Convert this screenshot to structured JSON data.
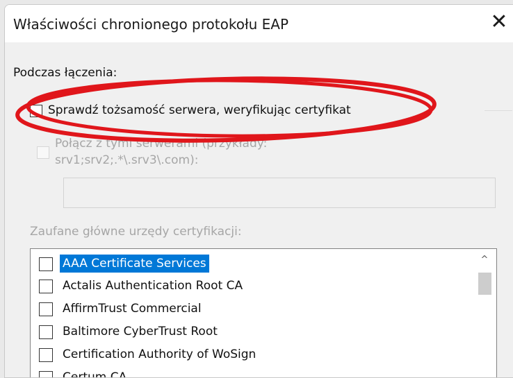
{
  "window": {
    "title": "Właściwości chronionego protokołu EAP",
    "close_glyph": "✕"
  },
  "section": {
    "heading": "Podczas łączenia:"
  },
  "verify_cert": {
    "label": "Sprawdź tożsamość serwera, weryfikując certyfikat",
    "checked": false
  },
  "connect_servers": {
    "label_line1": "Połącz z tymi serwerami (przykłady:",
    "label_line2": "srv1;srv2;.*\\.srv3\\.com):",
    "checked": false,
    "enabled": false,
    "input_value": ""
  },
  "trusted_roots": {
    "label": "Zaufane główne urzędy certyfikacji:",
    "items": [
      {
        "label": "AAA Certificate Services",
        "selected": true
      },
      {
        "label": "Actalis Authentication Root CA",
        "selected": false
      },
      {
        "label": "AffirmTrust Commercial",
        "selected": false
      },
      {
        "label": "Baltimore CyberTrust Root",
        "selected": false
      },
      {
        "label": "Certification Authority of WoSign",
        "selected": false
      },
      {
        "label": "Certum CA",
        "selected": false
      }
    ]
  },
  "scroll_up_glyph": "^",
  "annotation_color": "#e0161b"
}
